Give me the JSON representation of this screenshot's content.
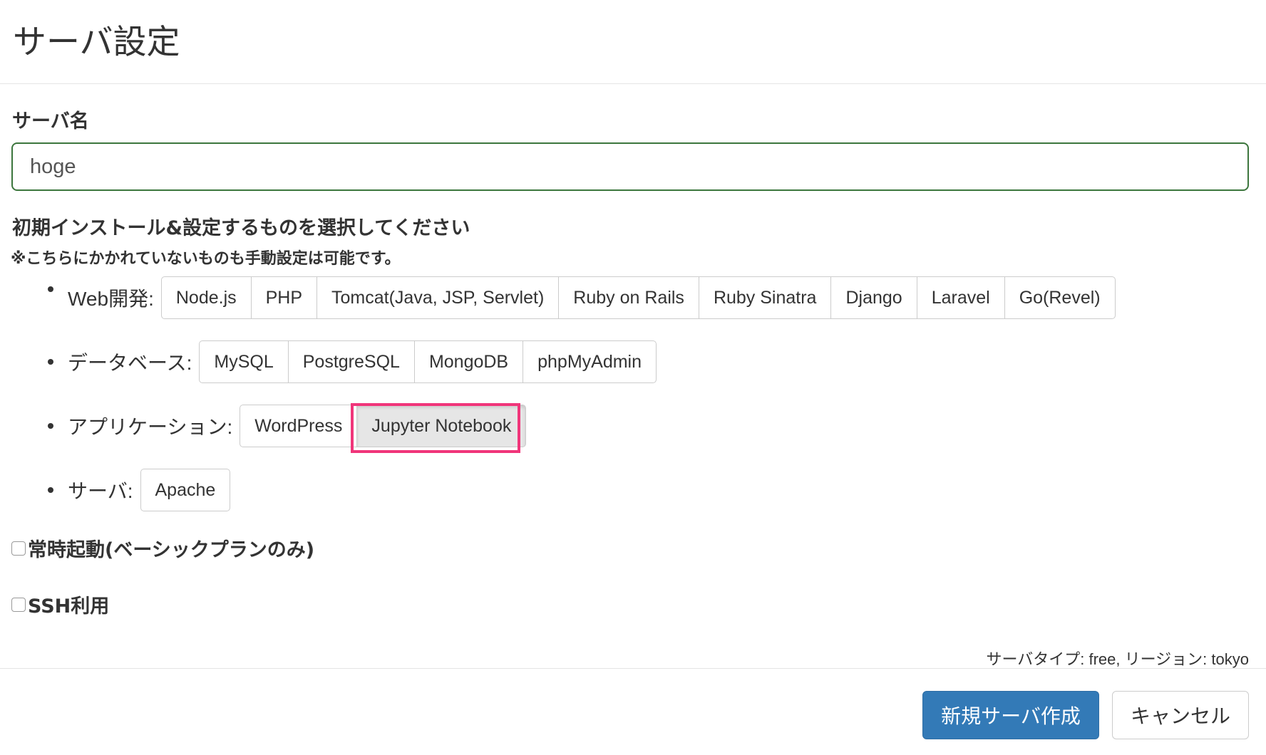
{
  "header": {
    "title": "サーバ設定"
  },
  "server_name": {
    "label": "サーバ名",
    "value": "hoge"
  },
  "install": {
    "heading": "初期インストール&設定するものを選択してください",
    "note": "※こちらにかかれていないものも手動設定は可能です。",
    "categories": [
      {
        "label": "Web開発:",
        "options": [
          "Node.js",
          "PHP",
          "Tomcat(Java, JSP, Servlet)",
          "Ruby on Rails",
          "Ruby Sinatra",
          "Django",
          "Laravel",
          "Go(Revel)"
        ]
      },
      {
        "label": "データベース:",
        "options": [
          "MySQL",
          "PostgreSQL",
          "MongoDB",
          "phpMyAdmin"
        ]
      },
      {
        "label": "アプリケーション:",
        "options": [
          "WordPress",
          "Jupyter Notebook"
        ],
        "selected": "Jupyter Notebook"
      },
      {
        "label": "サーバ:",
        "options": [
          "Apache"
        ]
      }
    ]
  },
  "options": {
    "always_on_label": "常時起動(ベーシックプランのみ)",
    "ssh_label": "SSH利用"
  },
  "footer": {
    "server_info": "サーバタイプ: free, リージョン: tokyo",
    "create_label": "新規サーバ作成",
    "cancel_label": "キャンセル"
  },
  "colors": {
    "primary": "#337ab7",
    "highlight": "#f0357a",
    "input_border": "#3c763d"
  }
}
